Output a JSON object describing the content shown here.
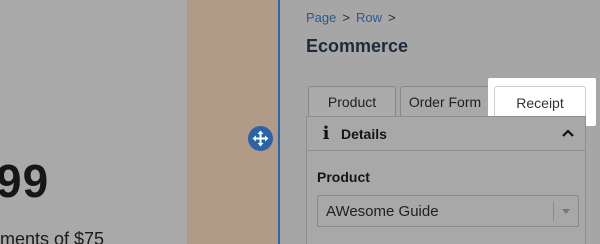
{
  "canvas": {
    "price_partial": "99",
    "payments_partial": "ments of $75"
  },
  "panel": {
    "breadcrumb": [
      "Page",
      "Row"
    ],
    "breadcrumb_separator": ">",
    "title": "Ecommerce",
    "tabs": [
      {
        "label": "Product"
      },
      {
        "label": "Order Form"
      },
      {
        "label": "Receipt"
      }
    ],
    "details": {
      "title": "Details",
      "product_label": "Product",
      "product_value": "AWesome Guide"
    }
  },
  "icons": {
    "move": "move-icon",
    "info": "info-icon",
    "collapse": "chevron-up-icon",
    "dropdown": "chevron-down-icon"
  },
  "colors": {
    "accent": "#2a63a8",
    "link": "#2a5a8e",
    "highlight": "#ffffff"
  }
}
